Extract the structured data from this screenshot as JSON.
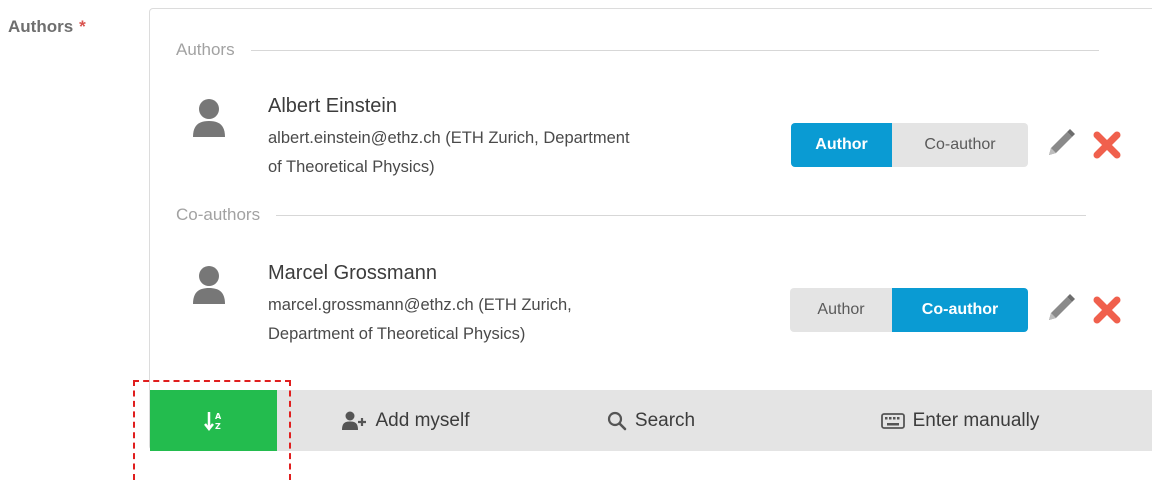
{
  "field": {
    "label": "Authors",
    "required_mark": "*"
  },
  "sections": {
    "authors_title": "Authors",
    "coauthors_title": "Co-authors"
  },
  "people": [
    {
      "name": "Albert Einstein",
      "detail_line1": "albert.einstein@ethz.ch (ETH Zurich, Department",
      "detail_line2": "of Theoretical Physics)",
      "role_options": [
        "Author",
        "Co-author"
      ],
      "selected_role": "Author"
    },
    {
      "name": "Marcel Grossmann",
      "detail_line1": "marcel.grossmann@ethz.ch (ETH Zurich,",
      "detail_line2": "Department of Theoretical Physics)",
      "role_options": [
        "Author",
        "Co-author"
      ],
      "selected_role": "Co-author"
    }
  ],
  "toolbar": {
    "sort_icon": "sort-alpha-icon",
    "add_myself_label": "Add myself",
    "search_label": "Search",
    "enter_manually_label": "Enter manually"
  },
  "colors": {
    "accent_blue": "#0a9bd3",
    "sort_green": "#23bc4e",
    "delete_red": "#f0604d",
    "required_red": "#d9534f",
    "highlight_red": "#e01e1e"
  }
}
